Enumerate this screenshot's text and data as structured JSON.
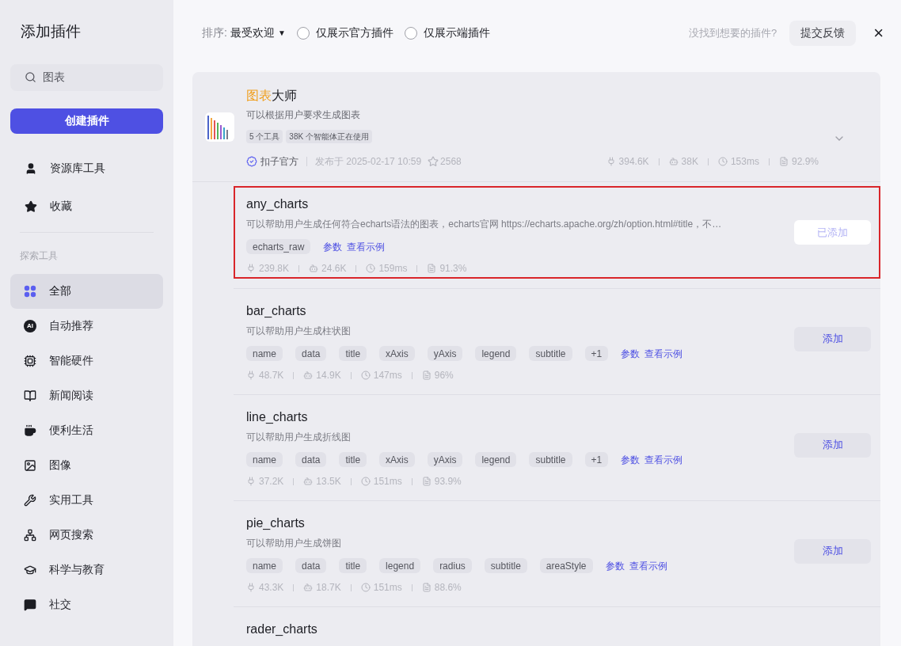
{
  "dialog": {
    "title": "添加插件",
    "close": "×"
  },
  "sidebar": {
    "search": {
      "value": "图表"
    },
    "create_button": "创建插件",
    "top_items": [
      {
        "kind": "user",
        "label": "资源库工具"
      },
      {
        "kind": "star",
        "label": "收藏"
      }
    ],
    "section_title": "探索工具",
    "categories": [
      {
        "kind": "grid",
        "label": "全部",
        "selected": true
      },
      {
        "kind": "ai",
        "glyph": "AI",
        "label": "自动推荐",
        "selected": false
      },
      {
        "kind": "chip",
        "label": "智能硬件",
        "selected": false
      },
      {
        "kind": "book",
        "label": "新闻阅读",
        "selected": false
      },
      {
        "kind": "cup",
        "label": "便利生活",
        "selected": false
      },
      {
        "kind": "image",
        "label": "图像",
        "selected": false
      },
      {
        "kind": "wrench",
        "label": "实用工具",
        "selected": false
      },
      {
        "kind": "network",
        "label": "网页搜索",
        "selected": false
      },
      {
        "kind": "cap",
        "label": "科学与教育",
        "selected": false
      },
      {
        "kind": "chat",
        "label": "社交",
        "selected": false
      }
    ]
  },
  "toolbar": {
    "sort_label": "排序:",
    "sort_value": "最受欢迎",
    "sort_caret": "▼",
    "filters": [
      {
        "label": "仅展示官方插件",
        "checked": false
      },
      {
        "label": "仅展示端插件",
        "checked": false
      }
    ],
    "feedback_prompt": "没找到想要的插件?",
    "feedback_button": "提交反馈"
  },
  "plugin": {
    "title_highlight": "图表",
    "title_rest": "大师",
    "description": "可以根据用户要求生成图表",
    "tags": [
      "5 个工具",
      "38K 个智能体正在使用"
    ],
    "publisher": "扣子官方",
    "published": "发布于 2025-02-17 10:59",
    "favorites": "2568",
    "expanded": true,
    "stats": [
      {
        "kind": "calls",
        "value": "394.6K"
      },
      {
        "kind": "bots",
        "value": "38K"
      },
      {
        "kind": "latency",
        "value": "153ms"
      },
      {
        "kind": "success",
        "value": "92.9%"
      }
    ]
  },
  "tools": [
    {
      "name": "any_charts",
      "description": "可以帮助用户生成任何符合echarts语法的图表，echarts官网 https://echarts.apache.org/zh/option.html#title，不…",
      "params": [
        "echarts_raw"
      ],
      "params_link": "参数",
      "example_link": "查看示例",
      "added": true,
      "button": "已添加",
      "highlighted": true,
      "stats": [
        {
          "kind": "calls",
          "value": "239.8K"
        },
        {
          "kind": "bots",
          "value": "24.6K"
        },
        {
          "kind": "latency",
          "value": "159ms"
        },
        {
          "kind": "success",
          "value": "91.3%"
        }
      ]
    },
    {
      "name": "bar_charts",
      "description": "可以帮助用户生成柱状图",
      "params": [
        "name",
        "data",
        "title",
        "xAxis",
        "yAxis",
        "legend",
        "subtitle",
        "+1"
      ],
      "params_link": "参数",
      "example_link": "查看示例",
      "added": false,
      "button": "添加",
      "highlighted": false,
      "stats": [
        {
          "kind": "calls",
          "value": "48.7K"
        },
        {
          "kind": "bots",
          "value": "14.9K"
        },
        {
          "kind": "latency",
          "value": "147ms"
        },
        {
          "kind": "success",
          "value": "96%"
        }
      ]
    },
    {
      "name": "line_charts",
      "description": "可以帮助用户生成折线图",
      "params": [
        "name",
        "data",
        "title",
        "xAxis",
        "yAxis",
        "legend",
        "subtitle",
        "+1"
      ],
      "params_link": "参数",
      "example_link": "查看示例",
      "added": false,
      "button": "添加",
      "highlighted": false,
      "stats": [
        {
          "kind": "calls",
          "value": "37.2K"
        },
        {
          "kind": "bots",
          "value": "13.5K"
        },
        {
          "kind": "latency",
          "value": "151ms"
        },
        {
          "kind": "success",
          "value": "93.9%"
        }
      ]
    },
    {
      "name": "pie_charts",
      "description": "可以帮助用户生成饼图",
      "params": [
        "name",
        "data",
        "title",
        "legend",
        "radius",
        "subtitle",
        "areaStyle"
      ],
      "params_link": "参数",
      "example_link": "查看示例",
      "added": false,
      "button": "添加",
      "highlighted": false,
      "stats": [
        {
          "kind": "calls",
          "value": "43.3K"
        },
        {
          "kind": "bots",
          "value": "18.7K"
        },
        {
          "kind": "latency",
          "value": "151ms"
        },
        {
          "kind": "success",
          "value": "88.6%"
        }
      ]
    },
    {
      "name": "rader_charts",
      "highlighted": false
    }
  ]
}
